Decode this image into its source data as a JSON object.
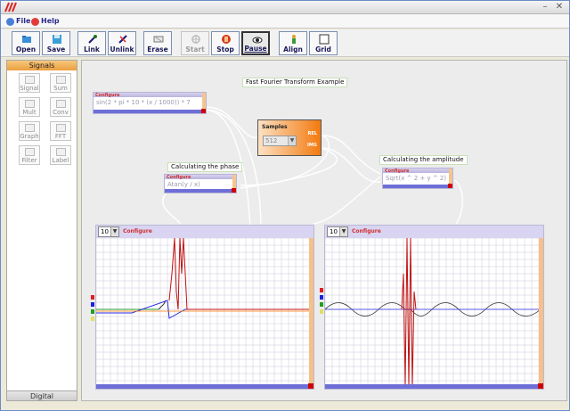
{
  "window": {
    "minimize_label": "–",
    "close_label": "✕"
  },
  "menu": {
    "file_label": "File",
    "help_label": "Help"
  },
  "toolbar": {
    "open": "Open",
    "save": "Save",
    "link": "Link",
    "unlink": "Unlink",
    "erase": "Erase",
    "start": "Start",
    "stop": "Stop",
    "pause": "Pause",
    "align": "Align",
    "grid": "Grid"
  },
  "left_panel": {
    "header": "Signals",
    "footer": "Digital",
    "items": [
      "Signal",
      "Sum",
      "Mult",
      "Conv",
      "Graph",
      "FFT",
      "Filter",
      "Label"
    ]
  },
  "canvas": {
    "title_label": "Fast Fourier Transform Example",
    "phase_label": "Calculating the phase",
    "amplitude_label": "Calculating the amplitude",
    "configure_label": "Configure",
    "signal_expr": "sin(2 * pi * 10 * (x / 1000)) * 7",
    "phase_expr": "Atan(y / x)",
    "amplitude_expr": "Sqrt(x ^ 2 + y ^ 2)",
    "samples": {
      "title": "Samples",
      "value": "512",
      "port_real": "REL",
      "port_img": "IMG"
    },
    "graph_left": {
      "zoom": "10",
      "configure": "Configure"
    },
    "graph_right": {
      "zoom": "10",
      "configure": "Configure"
    }
  },
  "colors": {
    "orange_accent": "#f27a0f",
    "block_header": "#d8d4f1",
    "block_footer": "#6e6ed8",
    "signal_red": "#c01010"
  }
}
